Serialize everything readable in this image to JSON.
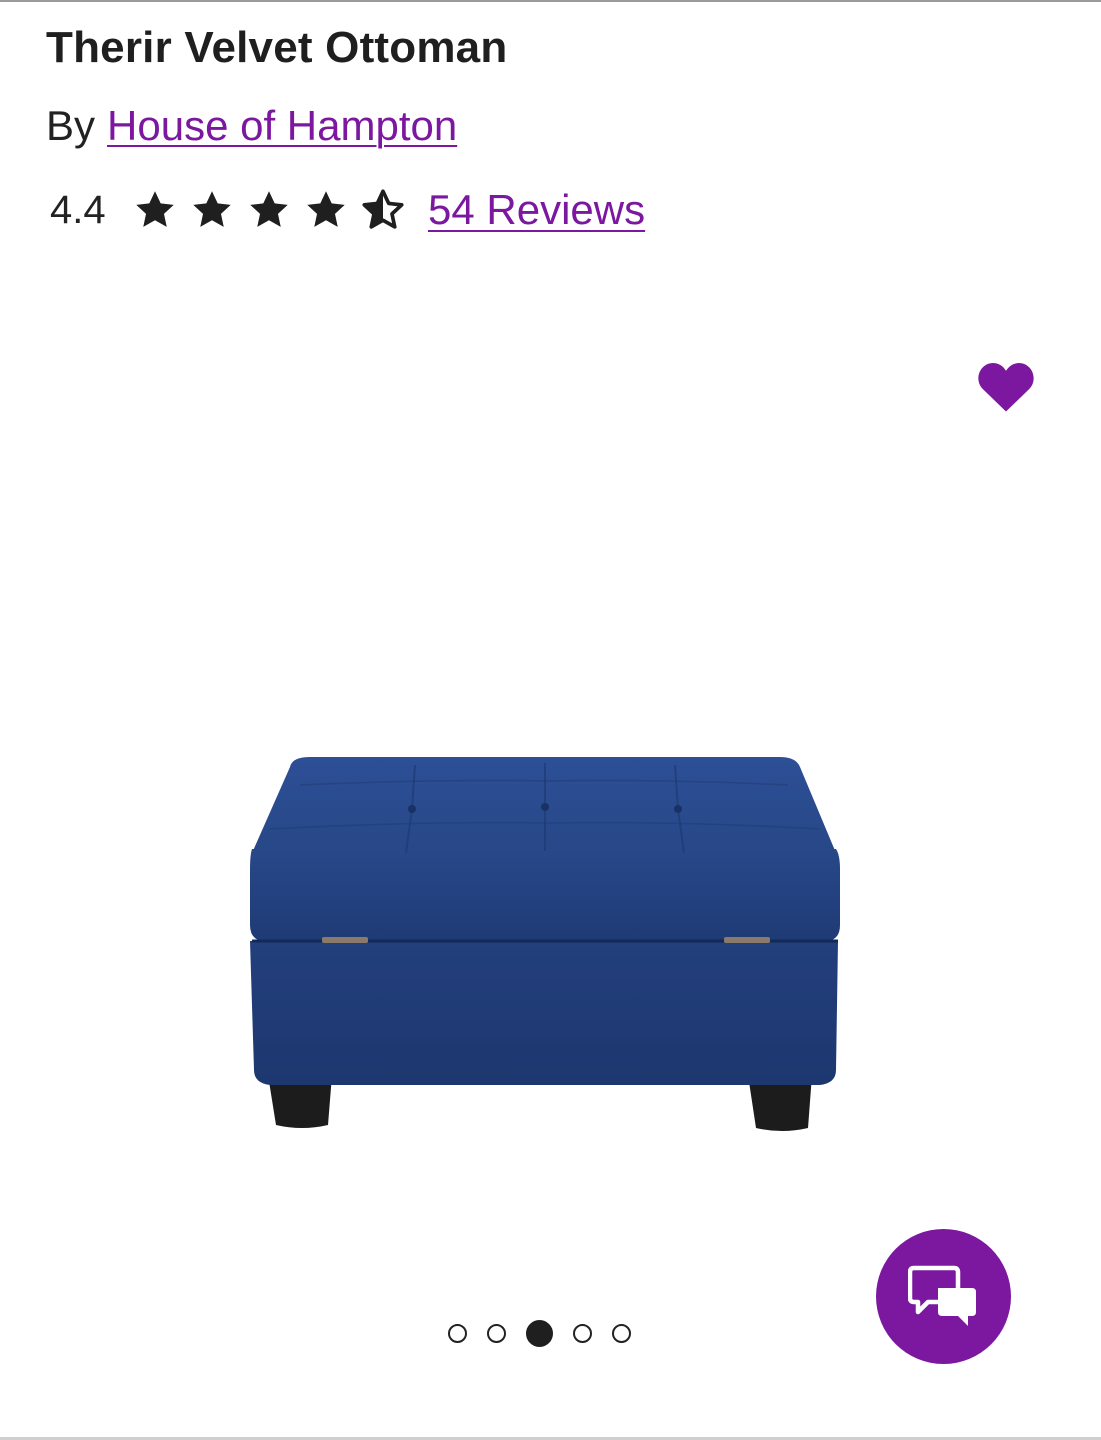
{
  "product": {
    "title": "Therir Velvet Ottoman",
    "by_label": "By",
    "brand": "House of Hampton",
    "rating": "4.4",
    "stars_filled": 4.4,
    "stars_total": 5,
    "reviews_link": "54 Reviews"
  },
  "gallery": {
    "dot_count": 5,
    "active_dot_index": 2
  },
  "colors": {
    "brand_purple": "#7b189f",
    "text_dark": "#222222",
    "ottoman_blue": "#23407f"
  },
  "icons": {
    "favorite": "heart-icon",
    "chat": "chat-bubbles-icon",
    "star": "star-icon",
    "half_star": "star-half-icon"
  }
}
